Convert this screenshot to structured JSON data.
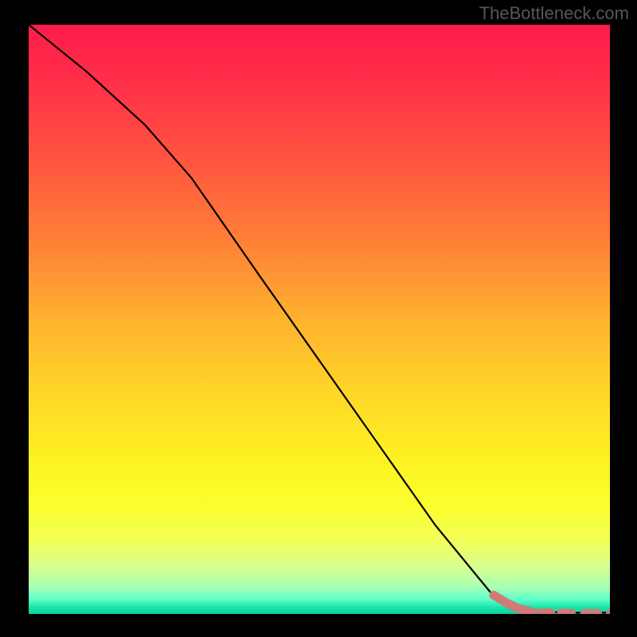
{
  "watermark": "TheBottleneck.com",
  "colors": {
    "black_line": "#000000",
    "marker_fill": "#cf7b78",
    "bg_black": "#000000"
  },
  "chart_data": {
    "type": "line",
    "title": "",
    "xlabel": "",
    "ylabel": "",
    "xlim": [
      0,
      100
    ],
    "ylim": [
      0,
      100
    ],
    "grid": false,
    "series": [
      {
        "name": "curve",
        "x": [
          0,
          10,
          20,
          28,
          40,
          50,
          60,
          70,
          80,
          86,
          90,
          94,
          100
        ],
        "y": [
          100,
          92,
          83,
          74,
          57,
          43,
          29,
          15,
          3,
          0.5,
          0.3,
          0.2,
          0.2
        ]
      }
    ],
    "markers": [
      {
        "x": 80.0,
        "y": 3.2
      },
      {
        "x": 81.0,
        "y": 2.6
      },
      {
        "x": 82.0,
        "y": 2.0
      },
      {
        "x": 83.0,
        "y": 1.5
      },
      {
        "x": 84.0,
        "y": 1.0
      },
      {
        "x": 85.0,
        "y": 0.7
      },
      {
        "x": 86.0,
        "y": 0.5
      },
      {
        "x": 88.0,
        "y": 0.35
      },
      {
        "x": 90.0,
        "y": 0.3
      },
      {
        "x": 91.5,
        "y": 0.28
      },
      {
        "x": 93.5,
        "y": 0.25
      },
      {
        "x": 95.5,
        "y": 0.22
      },
      {
        "x": 98.0,
        "y": 0.2
      },
      {
        "x": 100.0,
        "y": 0.2
      }
    ],
    "gradient_stops": [
      {
        "offset": 0.0,
        "color": "#fe1b4a"
      },
      {
        "offset": 0.12,
        "color": "#ff3548"
      },
      {
        "offset": 0.25,
        "color": "#ff5b3e"
      },
      {
        "offset": 0.38,
        "color": "#ff8436"
      },
      {
        "offset": 0.5,
        "color": "#ffb12f"
      },
      {
        "offset": 0.62,
        "color": "#ffd528"
      },
      {
        "offset": 0.74,
        "color": "#fdf222"
      },
      {
        "offset": 0.82,
        "color": "#fcff2f"
      },
      {
        "offset": 0.88,
        "color": "#f1ff5b"
      },
      {
        "offset": 0.92,
        "color": "#d8ff8e"
      },
      {
        "offset": 0.955,
        "color": "#a7ffb4"
      },
      {
        "offset": 0.975,
        "color": "#5effca"
      },
      {
        "offset": 0.99,
        "color": "#14e3a6"
      },
      {
        "offset": 1.0,
        "color": "#0dd39b"
      }
    ]
  }
}
